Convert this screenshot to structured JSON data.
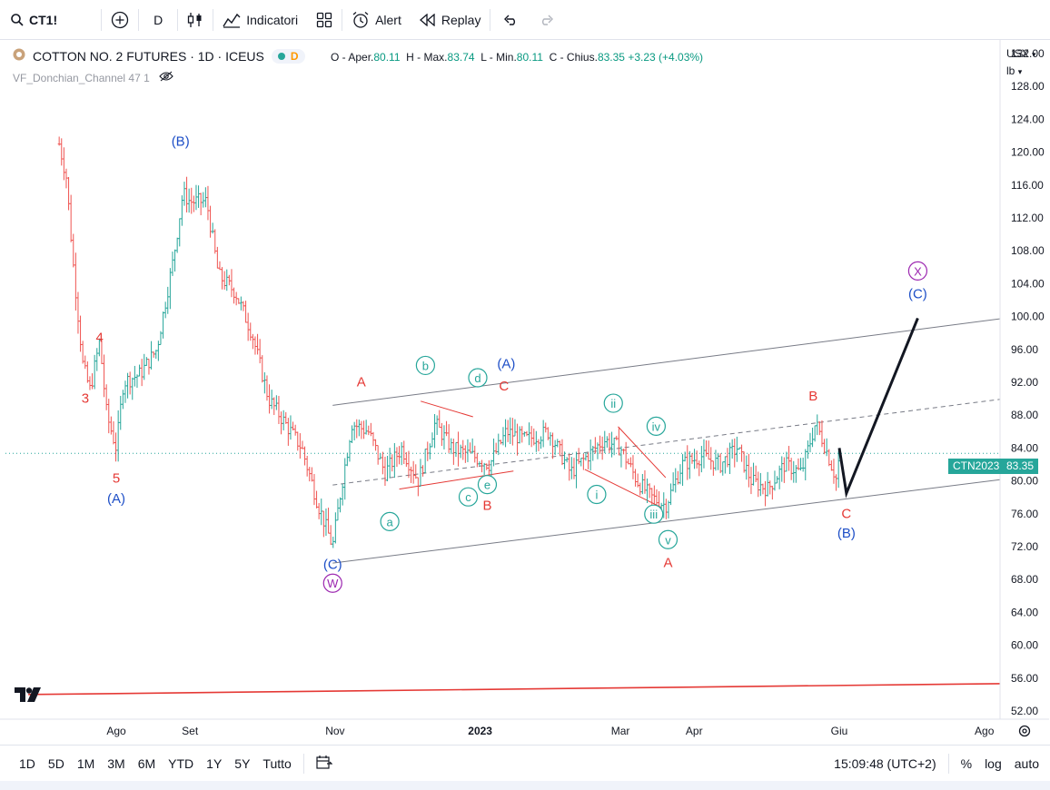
{
  "toolbar": {
    "symbol": "CT1!",
    "interval": "D",
    "indicators": "Indicatori",
    "alert": "Alert",
    "replay": "Replay"
  },
  "legend": {
    "title": "COTTON NO. 2 FUTURES · 1D · ICEUS",
    "badge": "D",
    "o_label": "O - Aper.",
    "o_value": "80.11",
    "h_label": "H - Max.",
    "h_value": "83.74",
    "l_label": "L - Min.",
    "l_value": "80.11",
    "c_label": "C - Chius.",
    "c_value": "83.35",
    "change": "+3.23 (+4.03%)",
    "indicator": "VF_Donchian_Channel 47 1"
  },
  "axis": {
    "currency": "USX",
    "unit": "lb",
    "price_ticks": [
      "132.00",
      "128.00",
      "124.00",
      "120.00",
      "116.00",
      "112.00",
      "108.00",
      "104.00",
      "100.00",
      "96.00",
      "92.00",
      "88.00",
      "84.00",
      "80.00",
      "76.00",
      "72.00",
      "68.00",
      "64.00",
      "60.00",
      "56.00",
      "52.00"
    ],
    "time_ticks": [
      "Ago",
      "Set",
      "Nov",
      "2023",
      "Mar",
      "Apr",
      "Giu",
      "Ago"
    ],
    "symbol_label": "CTN2023",
    "last_price": "83.35"
  },
  "colors": {
    "up": "#26a69a",
    "down": "#ef5350",
    "wave_red": "#e53935",
    "wave_blue": "#1e4fc7",
    "wave_teal": "#26a69a",
    "wave_purple": "#9c27b0",
    "support_line": "#e53935"
  },
  "chart_data": {
    "type": "candlestick",
    "title": "COTTON NO. 2 FUTURES · 1D · ICEUS",
    "ylabel": "USX / lb",
    "ylim": [
      51,
      133
    ],
    "price_path": [
      {
        "date": "2022-07-08",
        "price": 121
      },
      {
        "date": "2022-07-11",
        "price": 117
      },
      {
        "date": "2022-07-14",
        "price": 106
      },
      {
        "date": "2022-07-18",
        "price": 94
      },
      {
        "date": "2022-07-21",
        "price": 91
      },
      {
        "date": "2022-07-25",
        "price": 97
      },
      {
        "date": "2022-07-28",
        "price": 88
      },
      {
        "date": "2022-08-01",
        "price": 84
      },
      {
        "date": "2022-08-04",
        "price": 92
      },
      {
        "date": "2022-08-11",
        "price": 93
      },
      {
        "date": "2022-08-18",
        "price": 96
      },
      {
        "date": "2022-08-25",
        "price": 107
      },
      {
        "date": "2022-08-29",
        "price": 115
      },
      {
        "date": "2022-09-01",
        "price": 114
      },
      {
        "date": "2022-09-08",
        "price": 114
      },
      {
        "date": "2022-09-13",
        "price": 105
      },
      {
        "date": "2022-09-20",
        "price": 103
      },
      {
        "date": "2022-09-27",
        "price": 98
      },
      {
        "date": "2022-10-04",
        "price": 90
      },
      {
        "date": "2022-10-11",
        "price": 87
      },
      {
        "date": "2022-10-18",
        "price": 84
      },
      {
        "date": "2022-10-25",
        "price": 77
      },
      {
        "date": "2022-10-31",
        "price": 72
      },
      {
        "date": "2022-11-03",
        "price": 78
      },
      {
        "date": "2022-11-08",
        "price": 87
      },
      {
        "date": "2022-11-15",
        "price": 86
      },
      {
        "date": "2022-11-22",
        "price": 81
      },
      {
        "date": "2022-11-29",
        "price": 84
      },
      {
        "date": "2022-12-06",
        "price": 80
      },
      {
        "date": "2022-12-13",
        "price": 87
      },
      {
        "date": "2022-12-20",
        "price": 84
      },
      {
        "date": "2022-12-29",
        "price": 83
      },
      {
        "date": "2023-01-05",
        "price": 82
      },
      {
        "date": "2023-01-12",
        "price": 86
      },
      {
        "date": "2023-01-20",
        "price": 85
      },
      {
        "date": "2023-01-30",
        "price": 86
      },
      {
        "date": "2023-02-08",
        "price": 81
      },
      {
        "date": "2023-02-15",
        "price": 83
      },
      {
        "date": "2023-02-22",
        "price": 85
      },
      {
        "date": "2023-03-01",
        "price": 84
      },
      {
        "date": "2023-03-08",
        "price": 80
      },
      {
        "date": "2023-03-14",
        "price": 78
      },
      {
        "date": "2023-03-20",
        "price": 77
      },
      {
        "date": "2023-03-27",
        "price": 82
      },
      {
        "date": "2023-04-04",
        "price": 83
      },
      {
        "date": "2023-04-12",
        "price": 82
      },
      {
        "date": "2023-04-19",
        "price": 84
      },
      {
        "date": "2023-04-25",
        "price": 80
      },
      {
        "date": "2023-05-02",
        "price": 79
      },
      {
        "date": "2023-05-09",
        "price": 82
      },
      {
        "date": "2023-05-16",
        "price": 81
      },
      {
        "date": "2023-05-22",
        "price": 87
      },
      {
        "date": "2023-05-25",
        "price": 85
      },
      {
        "date": "2023-05-31",
        "price": 80
      },
      {
        "date": "2023-06-01",
        "price": 83.35
      }
    ],
    "projection": [
      {
        "date": "2023-06-01",
        "price": 84
      },
      {
        "date": "2023-06-04",
        "price": 78.5
      },
      {
        "date": "2023-07-04",
        "price": 99.8
      }
    ],
    "trend_lines": [
      {
        "name": "channel-upper",
        "from": {
          "date": "2022-10-31",
          "price": 89.2
        },
        "to": {
          "date": "2023-08-31",
          "price": 100.6
        },
        "style": "solid"
      },
      {
        "name": "channel-lower",
        "from": {
          "date": "2022-10-31",
          "price": 70
        },
        "to": {
          "date": "2023-08-31",
          "price": 81.0
        },
        "style": "solid"
      },
      {
        "name": "channel-mid",
        "from": {
          "date": "2022-10-31",
          "price": 79.5
        },
        "to": {
          "date": "2023-08-31",
          "price": 90.8
        },
        "style": "dashed"
      },
      {
        "name": "long-support",
        "from": {
          "date": "2022-06-25",
          "price": 54.0
        },
        "to": {
          "date": "2023-08-31",
          "price": 55.4
        },
        "style": "solid"
      },
      {
        "name": "triangle-top",
        "from": {
          "date": "2022-12-07",
          "price": 89.7
        },
        "to": {
          "date": "2022-12-29",
          "price": 87.8
        },
        "style": "solid"
      },
      {
        "name": "triangle-bottom",
        "from": {
          "date": "2022-11-28",
          "price": 79.0
        },
        "to": {
          "date": "2023-01-15",
          "price": 81.2
        },
        "style": "solid"
      },
      {
        "name": "wedge-top",
        "from": {
          "date": "2023-02-28",
          "price": 86.6
        },
        "to": {
          "date": "2023-03-20",
          "price": 80.4
        },
        "style": "solid"
      },
      {
        "name": "wedge-bottom",
        "from": {
          "date": "2023-02-14",
          "price": 81.4
        },
        "to": {
          "date": "2023-03-18",
          "price": 76.8
        },
        "style": "solid"
      }
    ],
    "wave_labels": [
      {
        "text": "3",
        "date": "2022-07-19",
        "price": 89.5,
        "style": "red"
      },
      {
        "text": "4",
        "date": "2022-07-25",
        "price": 96.9,
        "style": "red"
      },
      {
        "text": "5",
        "date": "2022-08-01",
        "price": 79.8,
        "style": "red"
      },
      {
        "text": "(A)",
        "date": "2022-08-01",
        "price": 77.3,
        "style": "blue"
      },
      {
        "text": "(B)",
        "date": "2022-08-28",
        "price": 120.8,
        "style": "blue"
      },
      {
        "text": "(C)",
        "date": "2022-10-31",
        "price": 69.3,
        "style": "blue"
      },
      {
        "text": "W",
        "date": "2022-10-31",
        "price": 67,
        "style": "purple-circle"
      },
      {
        "text": "A",
        "date": "2022-11-12",
        "price": 91.5,
        "style": "red"
      },
      {
        "text": "a",
        "date": "2022-11-24",
        "price": 74.5,
        "style": "teal-circle"
      },
      {
        "text": "b",
        "date": "2022-12-09",
        "price": 93.5,
        "style": "teal-circle"
      },
      {
        "text": "c",
        "date": "2022-12-27",
        "price": 77.5,
        "style": "teal-circle"
      },
      {
        "text": "d",
        "date": "2022-12-31",
        "price": 92.0,
        "style": "teal-circle"
      },
      {
        "text": "e",
        "date": "2023-01-04",
        "price": 79.0,
        "style": "teal-circle"
      },
      {
        "text": "B",
        "date": "2023-01-04",
        "price": 76.5,
        "style": "red"
      },
      {
        "text": "C",
        "date": "2023-01-11",
        "price": 91.0,
        "style": "red"
      },
      {
        "text": "(A)",
        "date": "2023-01-12",
        "price": 93.7,
        "style": "blue"
      },
      {
        "text": "i",
        "date": "2023-02-19",
        "price": 77.8,
        "style": "teal-circle"
      },
      {
        "text": "ii",
        "date": "2023-02-26",
        "price": 88.9,
        "style": "teal-circle"
      },
      {
        "text": "iii",
        "date": "2023-03-15",
        "price": 75.4,
        "style": "teal-circle"
      },
      {
        "text": "iv",
        "date": "2023-03-16",
        "price": 86.1,
        "style": "teal-circle"
      },
      {
        "text": "v",
        "date": "2023-03-21",
        "price": 72.3,
        "style": "teal-circle"
      },
      {
        "text": "A",
        "date": "2023-03-21",
        "price": 69.5,
        "style": "red"
      },
      {
        "text": "B",
        "date": "2023-05-21",
        "price": 89.8,
        "style": "red"
      },
      {
        "text": "C",
        "date": "2023-06-04",
        "price": 75.5,
        "style": "red"
      },
      {
        "text": "(B)",
        "date": "2023-06-04",
        "price": 73.1,
        "style": "blue"
      },
      {
        "text": "X",
        "date": "2023-07-04",
        "price": 105.0,
        "style": "purple-circle"
      },
      {
        "text": "(C)",
        "date": "2023-07-04",
        "price": 102.2,
        "style": "blue"
      }
    ]
  },
  "bottombar": {
    "ranges": [
      "1D",
      "5D",
      "1M",
      "3M",
      "6M",
      "YTD",
      "1Y",
      "5Y",
      "Tutto"
    ],
    "time": "15:09:48 (UTC+2)",
    "percent": "%",
    "log": "log",
    "auto": "auto"
  }
}
